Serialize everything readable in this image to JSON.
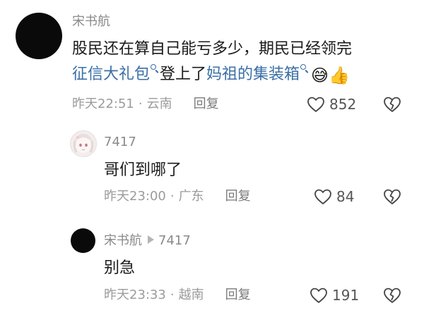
{
  "comments": [
    {
      "username": "宋书航",
      "content_line1": "股民还在算自己能亏多少，期民已经领完",
      "content_link1": "征信大礼包",
      "content_mid": "登上了",
      "content_link2": "妈祖的集装箱",
      "emojis": "😅👍",
      "time": "昨天22:51",
      "location": "云南",
      "reply_label": "回复",
      "likes": "852"
    },
    {
      "username": "7417",
      "content": "哥们到哪了",
      "time": "昨天23:00",
      "location": "广东",
      "reply_label": "回复",
      "likes": "84"
    },
    {
      "username": "宋书航",
      "reply_to": "7417",
      "content": "别急",
      "time": "昨天23:33",
      "location": "越南",
      "reply_label": "回复",
      "likes": "191"
    }
  ],
  "separator": "·",
  "colors": {
    "link": "#3a6ea5",
    "text": "#1a1a1a",
    "meta": "#9b9b9b"
  }
}
